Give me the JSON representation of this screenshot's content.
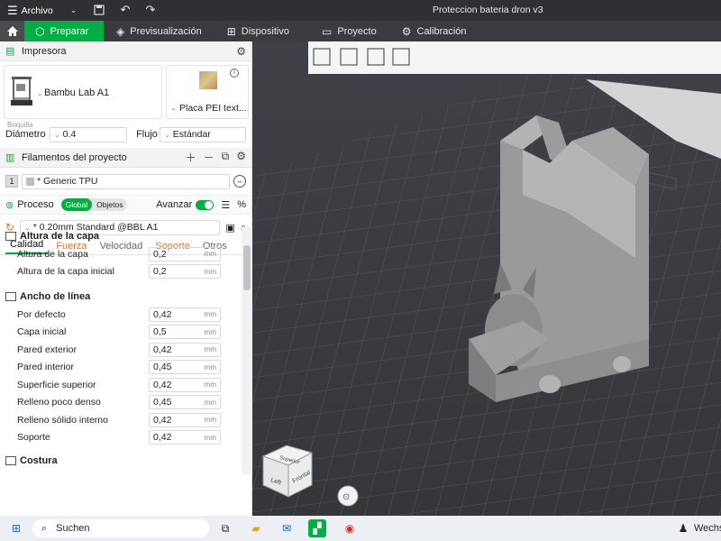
{
  "titlebar": {
    "menu_label": "Archivo",
    "title": "Proteccion bateria dron v3"
  },
  "tabs": [
    {
      "label": "Preparar"
    },
    {
      "label": "Previsualización"
    },
    {
      "label": "Dispositivo"
    },
    {
      "label": "Proyecto"
    },
    {
      "label": "Calibración"
    }
  ],
  "printer": {
    "section_title": "Impresora",
    "name": "Bambu Lab A1",
    "plate": "Placa PEI text...",
    "caption": "Boquilla",
    "diameter_label": "Diámetro",
    "diameter_value": "0.4",
    "flow_label": "Flujo",
    "flow_value": "Estándar"
  },
  "filaments": {
    "section_title": "Filamentos del proyecto",
    "items": [
      {
        "index": "1",
        "name": "* Generic TPU"
      }
    ]
  },
  "process": {
    "label": "Proceso",
    "seg_global": "Global",
    "seg_objects": "Objetos",
    "advanced_label": "Avanzar",
    "preset": "* 0.20mm Standard @BBL A1",
    "subtabs": [
      "Calidad",
      "Fuerza",
      "Velocidad",
      "Soporte",
      "Otros"
    ]
  },
  "params": {
    "layer_height": {
      "title": "Altura de la capa",
      "rows": [
        {
          "label": "Altura de la capa",
          "value": "0,2",
          "unit": "mm"
        },
        {
          "label": "Altura de la capa inicial",
          "value": "0,2",
          "unit": "mm"
        }
      ]
    },
    "line_width": {
      "title": "Ancho de línea",
      "rows": [
        {
          "label": "Por defecto",
          "value": "0,42",
          "unit": "mm"
        },
        {
          "label": "Capa inicial",
          "value": "0,5",
          "unit": "mm"
        },
        {
          "label": "Pared exterior",
          "value": "0,42",
          "unit": "mm"
        },
        {
          "label": "Pared interior",
          "value": "0,45",
          "unit": "mm"
        },
        {
          "label": "Superficie superior",
          "value": "0,42",
          "unit": "mm"
        },
        {
          "label": "Relleno poco denso",
          "value": "0,45",
          "unit": "mm"
        },
        {
          "label": "Relleno sólido interno",
          "value": "0,42",
          "unit": "mm"
        },
        {
          "label": "Soporte",
          "value": "0,42",
          "unit": "mm"
        }
      ]
    },
    "seam": {
      "title": "Costura"
    }
  },
  "viewport": {
    "cube_top": "Superior",
    "cube_left": "Left",
    "cube_front": "Frontal"
  },
  "taskbar": {
    "search_label": "Suchen",
    "tray_text": "Wechs"
  }
}
